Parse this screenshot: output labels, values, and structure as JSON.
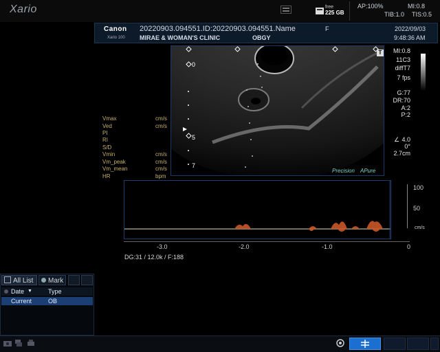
{
  "app": {
    "logo": "Xario"
  },
  "system": {
    "disk_label": "free",
    "disk_size": "225 GB",
    "ap": "AP:100%",
    "mi": "MI:0.8",
    "tib": "TIB:1.0",
    "tis": "TIS:0.5"
  },
  "header": {
    "brand": "Canon",
    "model": "Xario 100",
    "patient_id": "20220903.094551.ID:20220903.094551.Name",
    "sex": "F",
    "hospital": "MIRAE & WOMAN'S CLINIC",
    "department": "OBGY",
    "date": "2022/09/03",
    "time": "9:48:36 AM"
  },
  "image": {
    "depth_marks": [
      "0",
      "5",
      "7"
    ],
    "precision_label": "Precision",
    "apure_label": "APure",
    "t_marker": "T"
  },
  "params": {
    "mi": "MI:0.8",
    "probe": "11C3",
    "mode": "diffT7",
    "fps": "7 fps",
    "gain": "G:77",
    "dr": "DR:70",
    "a": "A:2",
    "p": "P:2",
    "angle": "4.0",
    "angle2": "0°",
    "depth": "2.7cm"
  },
  "measurements": [
    {
      "label": "Vmax",
      "unit": "cm/s"
    },
    {
      "label": "Ved",
      "unit": "cm/s"
    },
    {
      "label": "PI",
      "unit": ""
    },
    {
      "label": "RI",
      "unit": ""
    },
    {
      "label": "S/D",
      "unit": ""
    },
    {
      "label": "Vmin",
      "unit": "cm/s"
    },
    {
      "label": "Vm_peak",
      "unit": "cm/s"
    },
    {
      "label": "Vm_mean",
      "unit": "cm/s"
    },
    {
      "label": "HR",
      "unit": "bpm"
    }
  ],
  "doppler": {
    "scale": [
      "100",
      "50",
      "cm/s"
    ],
    "time_ticks": [
      "-3.0",
      "-2.0",
      "-1.0",
      "0"
    ],
    "info": "DG:31   / 12.0k  / F:188"
  },
  "list": {
    "tab_all": "All List",
    "tab_mark": "Mark",
    "col_date": "Date",
    "col_type": "Type",
    "row_name": "Current",
    "row_type": "OB"
  }
}
